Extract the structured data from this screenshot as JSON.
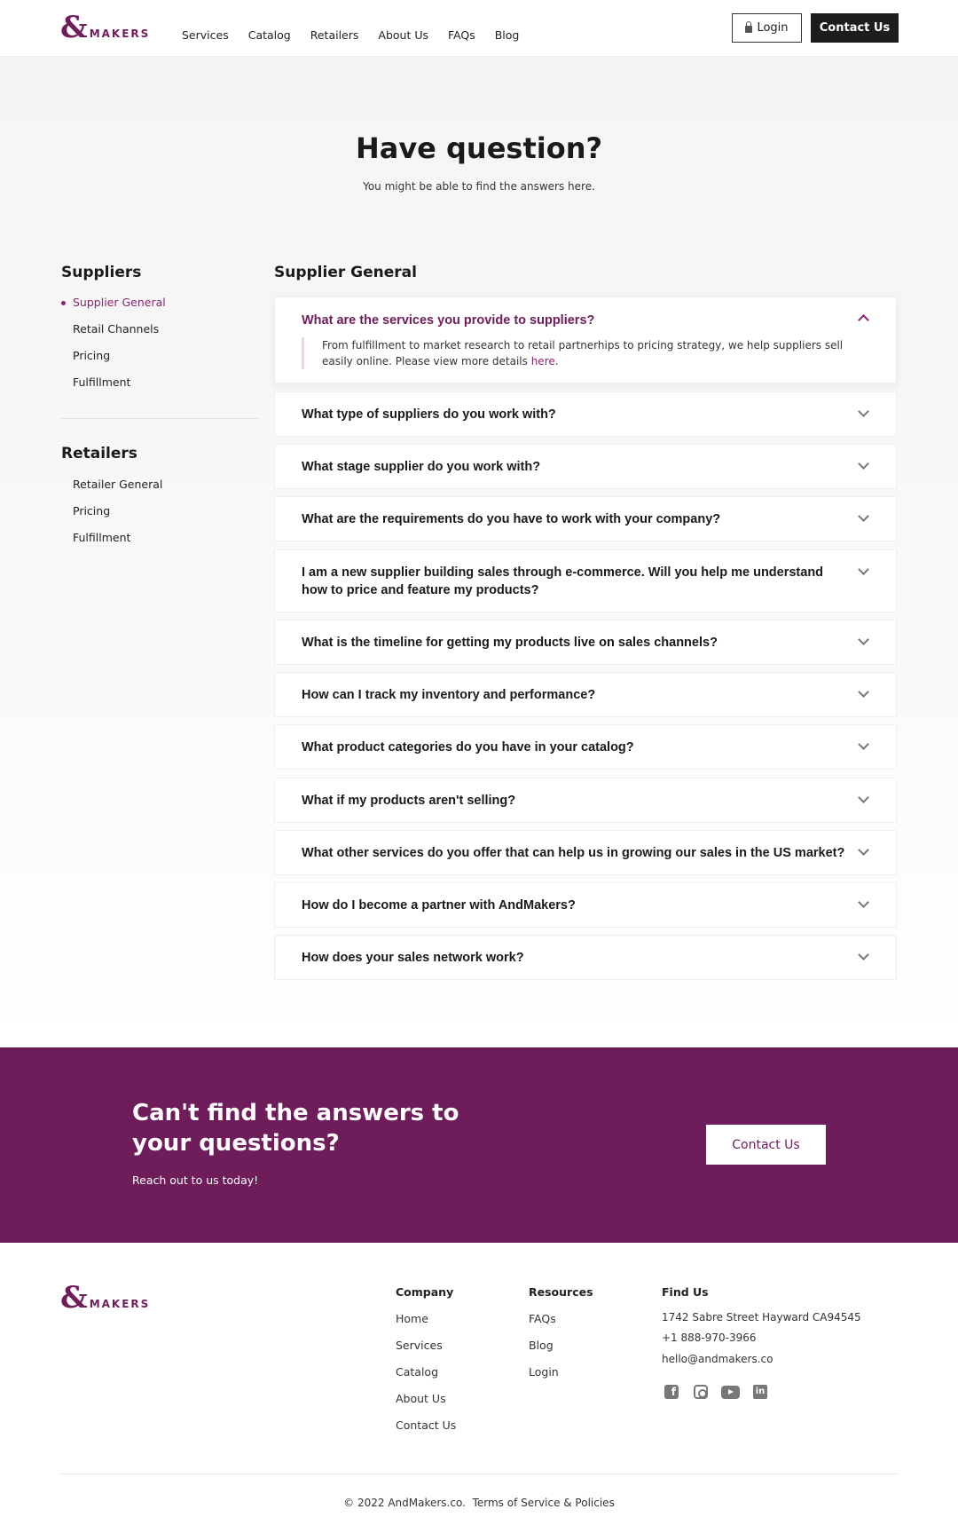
{
  "brand": {
    "symbol": "&",
    "name": "MAKERS"
  },
  "nav": {
    "items": [
      "Services",
      "Catalog",
      "Retailers",
      "About Us",
      "FAQs",
      "Blog"
    ],
    "login_label": "Login",
    "contact_label": "Contact Us"
  },
  "hero": {
    "title": "Have question?",
    "subtitle": "You might be able to find the answers here."
  },
  "sidebar": {
    "groups": [
      {
        "title": "Suppliers",
        "items": [
          "Supplier General",
          "Retail Channels",
          "Pricing",
          "Fulfillment"
        ],
        "active": "Supplier General"
      },
      {
        "title": "Retailers",
        "items": [
          "Retailer General",
          "Pricing",
          "Fulfillment"
        ]
      }
    ]
  },
  "faq": {
    "heading": "Supplier General",
    "items": [
      {
        "question": "What are the services you provide to suppliers?",
        "open": true,
        "answer": "From fulfillment to market research to retail partnerhips to pricing strategy, we help suppliers sell easily online. Please view more details ",
        "answer_link": "here",
        "answer_end": "."
      },
      {
        "question": "What type of suppliers do you work with?"
      },
      {
        "question": "What stage supplier do you work with?"
      },
      {
        "question": "What are the requirements do you have to work with your company?"
      },
      {
        "question": "I am a new supplier building sales through e-commerce. Will you help me understand how to price and feature my products?"
      },
      {
        "question": "What is the timeline for getting my products live on sales channels?"
      },
      {
        "question": "How can I track my inventory and performance?"
      },
      {
        "question": "What product categories do you have in your catalog?"
      },
      {
        "question": "What if my products aren't selling?"
      },
      {
        "question": "What other services do you offer that can help us in growing our sales in the US market?"
      },
      {
        "question": "How do I become a partner with AndMakers?"
      },
      {
        "question": "How does your sales network work?"
      }
    ]
  },
  "cta": {
    "title": "Can't find the answers to your questions?",
    "subtitle": "Reach out to us today!",
    "button": "Contact Us"
  },
  "footer": {
    "company": {
      "title": "Company",
      "links": [
        "Home",
        "Services",
        "Catalog",
        "About Us",
        "Contact Us"
      ]
    },
    "resources": {
      "title": "Resources",
      "links": [
        "FAQs",
        "Blog",
        "Login"
      ]
    },
    "find_us": {
      "title": "Find Us",
      "address": "1742 Sabre Street Hayward CA94545",
      "phone": "+1 888-970-3966",
      "email": "hello@andmakers.co"
    },
    "social": [
      "facebook-icon",
      "instagram-icon",
      "youtube-icon",
      "linkedin-icon"
    ],
    "copyright": "© 2022 AndMakers.co.",
    "terms": "Terms of Service & Policies"
  },
  "colors": {
    "brand": "#6e1c5a",
    "accent": "#8a2371",
    "dark": "#1d1d1d"
  }
}
